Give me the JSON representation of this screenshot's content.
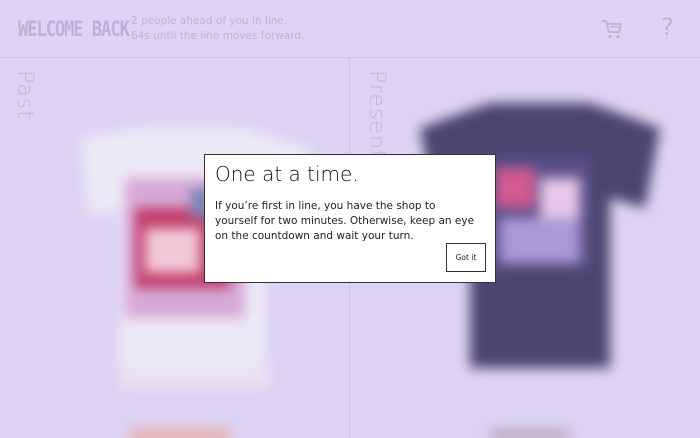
{
  "header": {
    "logo_text": "WELCOME BACK",
    "queue_line1": "2 people ahead of you in line.",
    "queue_line2": "64s until the line moves forward.",
    "cart_icon": "cart-icon",
    "help_label": "?"
  },
  "panels": {
    "past_label": "Past",
    "present_label": "Present"
  },
  "modal": {
    "title": "One at a time.",
    "body": "If you’re first in line, you have the shop to yourself for two minutes. Otherwise, keep an eye on the countdown and wait your turn.",
    "button_label": "Got it"
  },
  "colors": {
    "background": "#dcd3f3",
    "modal_bg": "#ffffff",
    "muted_text": "#bcb2da"
  }
}
